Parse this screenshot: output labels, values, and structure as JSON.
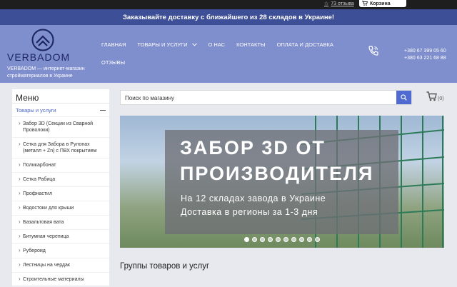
{
  "topbar": {
    "reviews": "73 отзыва",
    "cart_label": "Корзина"
  },
  "promo": {
    "text": "Заказывайте доставку с ближайшего из 28 складов в Украине!"
  },
  "header": {
    "logo_text": "VERBADOM",
    "tagline": "VERBADOM — интернет-магазин стройматериалов в Украине",
    "nav": [
      "Главная",
      "Товары и услуги",
      "О нас",
      "Контакты",
      "Оплата и доставка"
    ],
    "nav_row2": "Отзывы",
    "phones": [
      "+380 67 399 05 60",
      "+380 63 221 68 88"
    ]
  },
  "sidebar": {
    "title": "Меню",
    "category": "Товары и услуги",
    "items": [
      "Забор 3D (Секции из Сварной Проволоки)",
      "Сетка для Забора в Рулонах (металл + Zn) с ПВХ покрытием",
      "Поликарбонат",
      "Сетка Рабица",
      "Профнастил",
      "Водостоки для крыши",
      "Базальтовая вата",
      "Битумная черепица",
      "Рубероид",
      "Лестницы на чердак",
      "Строительные материалы"
    ]
  },
  "search": {
    "placeholder": "Поиск по магазину"
  },
  "cart": {
    "count": "(0)"
  },
  "banner": {
    "title_line1": "ЗАБОР 3D ОТ",
    "title_line2": "ПРОИЗВОДИТЕЛЯ",
    "sub_line1": "На 12 складах завода в Украине",
    "sub_line2": "Доставка в регионы за 1-3 дня",
    "slides": 10,
    "active_slide": 1
  },
  "groups": {
    "title": "Группы товаров и услуг"
  },
  "colors": {
    "accent": "#4f6bd1",
    "header_bg": "#7f8ecd",
    "promo_bg": "#3d4f97"
  }
}
